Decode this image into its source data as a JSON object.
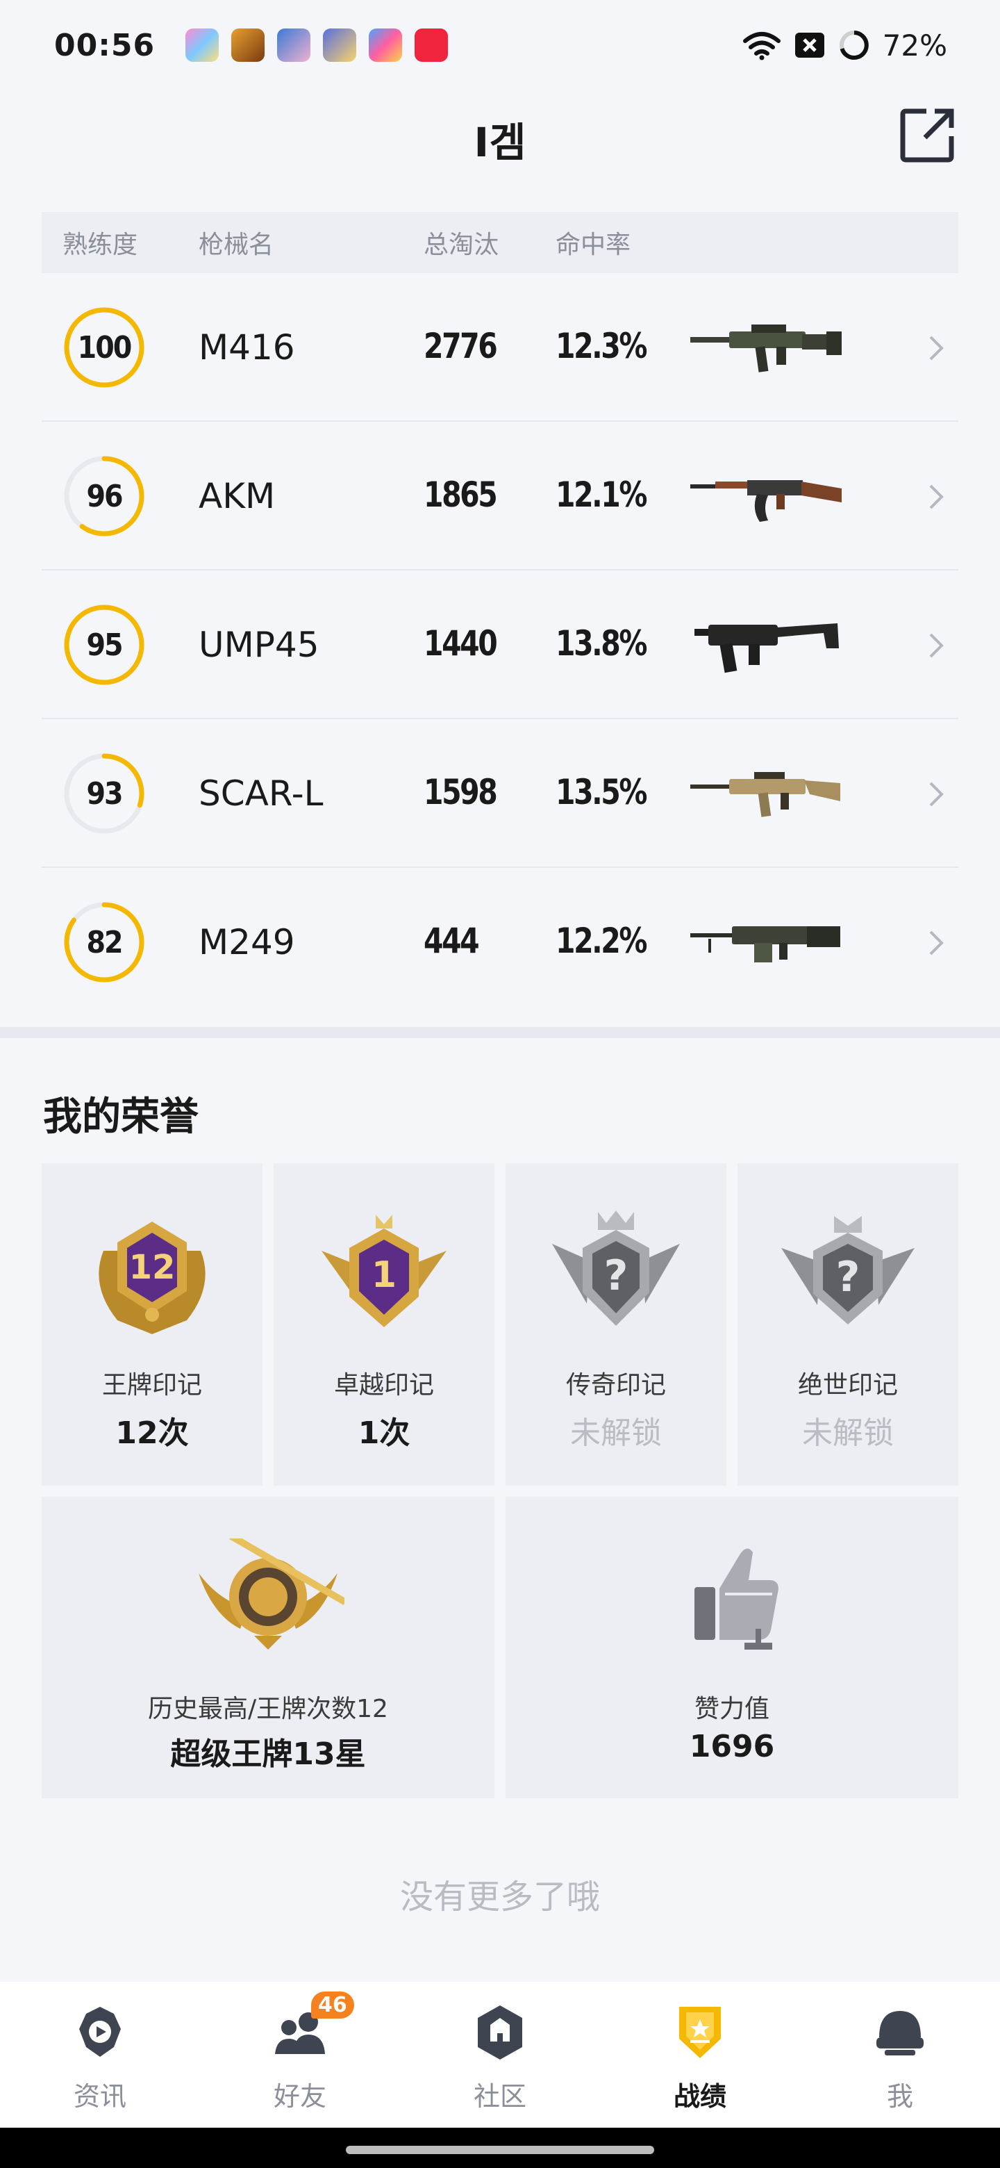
{
  "status_bar": {
    "time": "00:56",
    "battery": "72%"
  },
  "header": {
    "title": "I겜"
  },
  "table": {
    "headers": {
      "proficiency": "熟练度",
      "weapon": "枪械名",
      "kills": "总淘汰",
      "hit_rate": "命中率"
    },
    "rows": [
      {
        "proficiency": "100",
        "ring_fraction": 1.0,
        "name": "M416",
        "kills": "2776",
        "hit_rate": "12.3%",
        "gun_icon": "rifle-icon"
      },
      {
        "proficiency": "96",
        "ring_fraction": 0.6,
        "name": "AKM",
        "kills": "1865",
        "hit_rate": "12.1%",
        "gun_icon": "ak-rifle-icon"
      },
      {
        "proficiency": "95",
        "ring_fraction": 1.0,
        "name": "UMP45",
        "kills": "1440",
        "hit_rate": "13.8%",
        "gun_icon": "smg-icon"
      },
      {
        "proficiency": "93",
        "ring_fraction": 0.3,
        "name": "SCAR-L",
        "kills": "1598",
        "hit_rate": "13.5%",
        "gun_icon": "scar-rifle-icon"
      },
      {
        "proficiency": "82",
        "ring_fraction": 0.85,
        "name": "M249",
        "kills": "444",
        "hit_rate": "12.2%",
        "gun_icon": "lmg-icon"
      }
    ]
  },
  "honor": {
    "title": "我的荣誉",
    "badges": [
      {
        "name": "王牌印记",
        "value": "12次",
        "locked": false,
        "icon": "ace-badge-icon"
      },
      {
        "name": "卓越印记",
        "value": "1次",
        "locked": false,
        "icon": "excellent-badge-icon"
      },
      {
        "name": "传奇印记",
        "value": "未解锁",
        "locked": true,
        "icon": "legend-badge-icon"
      },
      {
        "name": "绝世印记",
        "value": "未解锁",
        "locked": true,
        "icon": "peerless-badge-icon"
      }
    ],
    "stats": [
      {
        "label": "历史最高/王牌次数12",
        "value": "超级王牌13星",
        "icon": "tier-badge-icon"
      },
      {
        "label": "赞力值",
        "value": "1696",
        "icon": "thumbs-up-icon"
      }
    ]
  },
  "footer_text": "没有更多了哦",
  "nav": {
    "items": [
      {
        "label": "资讯",
        "icon": "news-icon"
      },
      {
        "label": "好友",
        "icon": "friends-icon",
        "badge": "46"
      },
      {
        "label": "社区",
        "icon": "community-icon"
      },
      {
        "label": "战绩",
        "icon": "record-icon",
        "active": true
      },
      {
        "label": "我",
        "icon": "profile-icon"
      }
    ]
  },
  "colors": {
    "accent": "#f5b800",
    "ring_track": "#e7e9ee",
    "badge": "#f5821f"
  }
}
